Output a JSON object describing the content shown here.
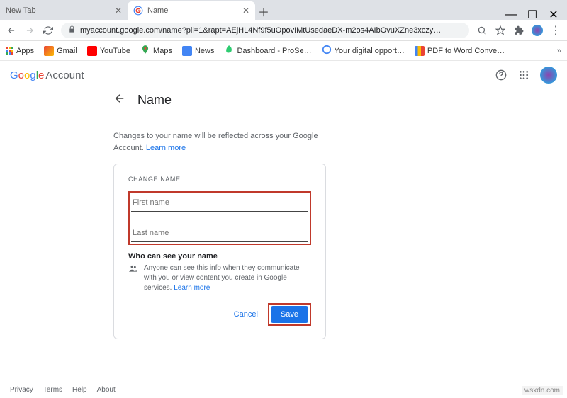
{
  "tabs": [
    {
      "title": "New Tab",
      "active": false
    },
    {
      "title": "Name",
      "active": true
    }
  ],
  "address": {
    "url": "myaccount.google.com/name?pli=1&rapt=AEjHL4Nf9f5uOpovIMtUsedaeDX-m2os4AIbOvuXZne3xczy…"
  },
  "bookmarks": {
    "apps": "Apps",
    "items": [
      {
        "label": "Gmail"
      },
      {
        "label": "YouTube"
      },
      {
        "label": "Maps"
      },
      {
        "label": "News"
      },
      {
        "label": "Dashboard - ProSe…"
      },
      {
        "label": "Your digital opport…"
      },
      {
        "label": "PDF to Word Conve…"
      }
    ]
  },
  "header": {
    "brand_account": "Account"
  },
  "page": {
    "title": "Name",
    "description_pre": "Changes to your name will be reflected across your Google Account. ",
    "learn_more": "Learn more"
  },
  "card": {
    "section_label": "CHANGE NAME",
    "first_name_placeholder": "First name",
    "last_name_placeholder": "Last name",
    "first_name_value": "",
    "last_name_value": "",
    "visibility_title": "Who can see your name",
    "visibility_text_pre": "Anyone can see this info when they communicate with you or view content you create in Google services. ",
    "visibility_learn_more": "Learn more",
    "cancel": "Cancel",
    "save": "Save"
  },
  "footer": {
    "items": [
      "Privacy",
      "Terms",
      "Help",
      "About"
    ]
  },
  "watermark": "wsxdn.com"
}
